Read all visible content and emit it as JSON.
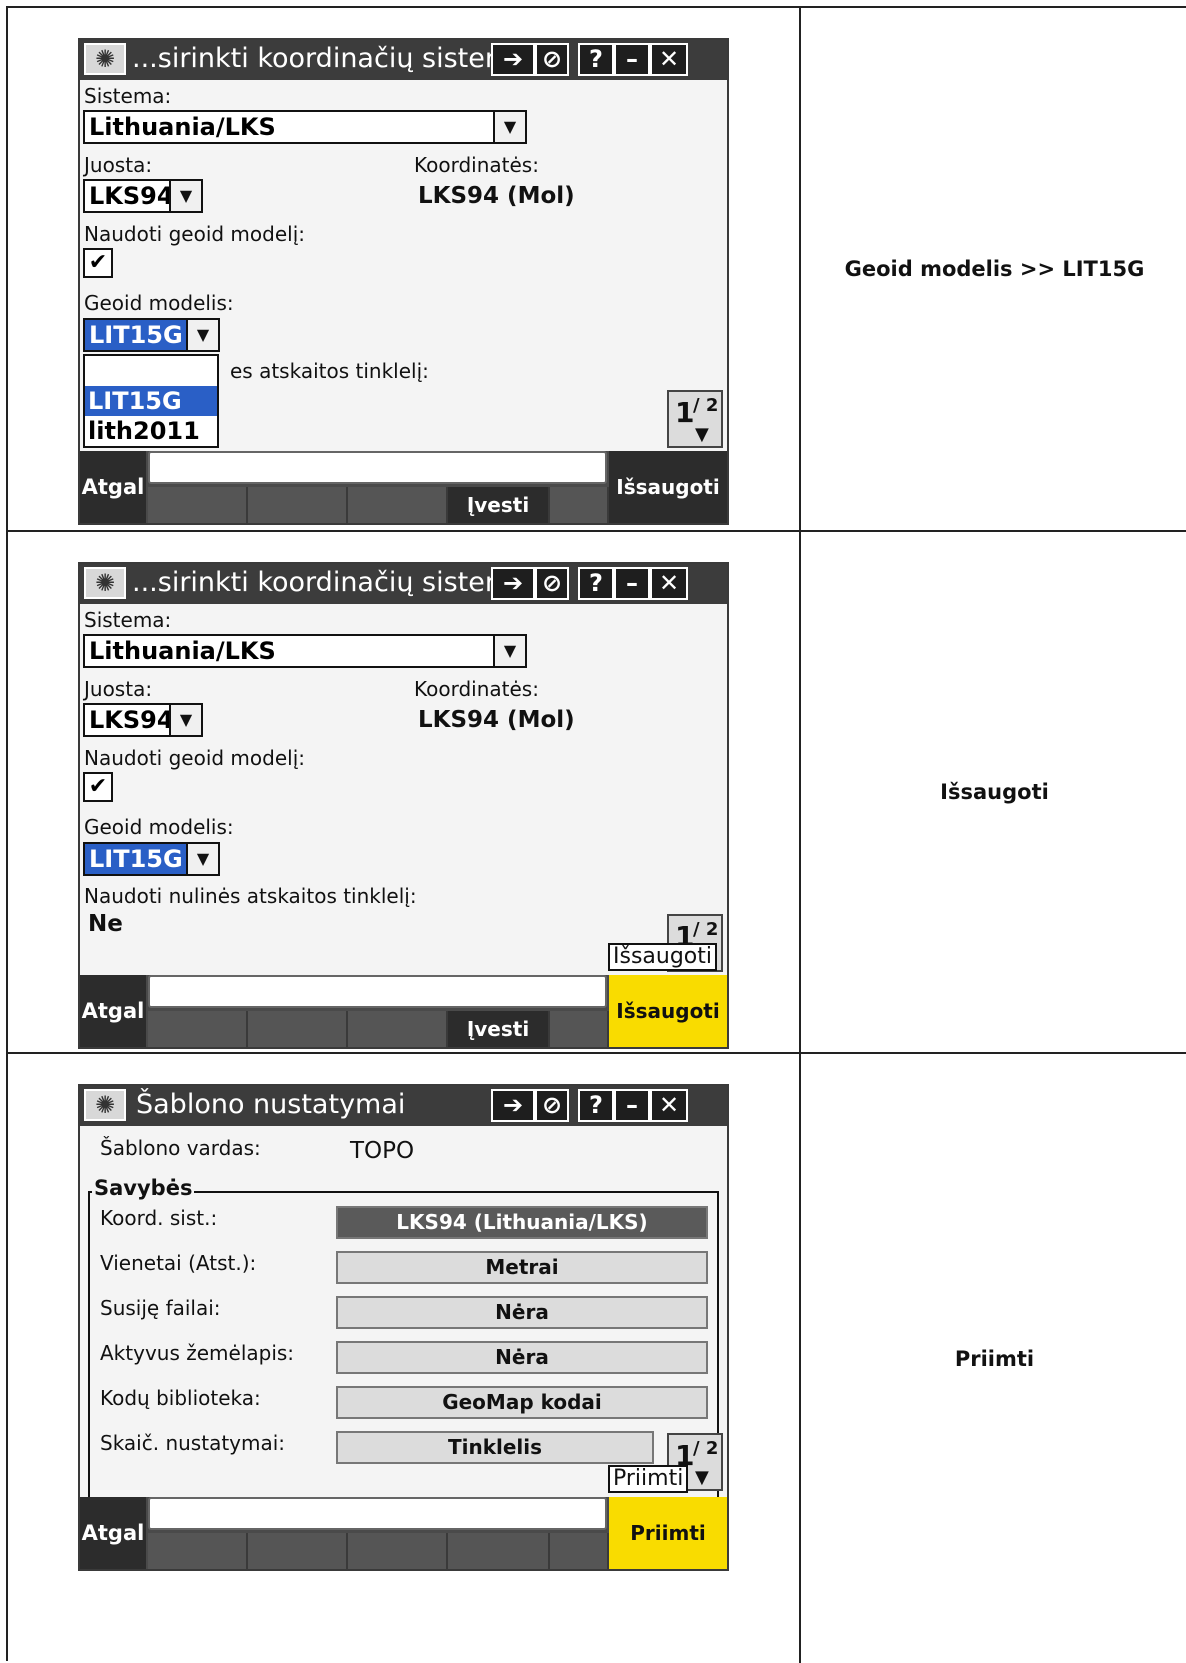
{
  "rows": [
    {
      "caption": "Geoid modelis >> LIT15G",
      "screen": {
        "title": "...sirinkti koordinačių sistemą",
        "sistema_label": "Sistema:",
        "sistema_value": "Lithuania/LKS",
        "juosta_label": "Juosta:",
        "juosta_value": "LKS94",
        "koordinates_label": "Koordinatės:",
        "koordinates_value": "LKS94 (Mol)",
        "geoid_use_label": "Naudoti geoid modelį:",
        "geoid_model_label": "Geoid modelis:",
        "geoid_model_value": "LIT15G",
        "partial_label": "es atskaitos tinklelį:",
        "dropdown_options": [
          "",
          "LIT15G",
          "lith2011"
        ],
        "page": "1",
        "page_total": "/ 2",
        "back": "Atgal",
        "enter": "Įvesti",
        "save": "Išsaugoti"
      }
    },
    {
      "caption": "Išsaugoti",
      "screen": {
        "title": "...sirinkti koordinačių sistemą",
        "sistema_label": "Sistema:",
        "sistema_value": "Lithuania/LKS",
        "juosta_label": "Juosta:",
        "juosta_value": "LKS94",
        "koordinates_label": "Koordinatės:",
        "koordinates_value": "LKS94 (Mol)",
        "geoid_use_label": "Naudoti geoid modelį:",
        "geoid_model_label": "Geoid modelis:",
        "geoid_model_value": "LIT15G",
        "grid_label": "Naudoti nulinės atskaitos tinklelį:",
        "grid_value": "Ne",
        "tooltip": "Išsaugoti",
        "page": "1",
        "page_total": "/ 2",
        "back": "Atgal",
        "enter": "Įvesti",
        "save": "Išsaugoti"
      }
    },
    {
      "caption": "Priimti",
      "screen": {
        "title": "Šablono nustatymai",
        "name_label": "Šablono vardas:",
        "name_value": "TOPO",
        "group_title": "Savybės",
        "properties": [
          {
            "label": "Koord. sist.:",
            "value": "LKS94 (Lithuania/LKS)"
          },
          {
            "label": "Vienetai (Atst.):",
            "value": "Metrai"
          },
          {
            "label": "Susiję failai:",
            "value": "Nėra"
          },
          {
            "label": "Aktyvus žemėlapis:",
            "value": "Nėra"
          },
          {
            "label": "Kodų biblioteka:",
            "value": "GeoMap kodai"
          },
          {
            "label": "Skaič. nustatymai:",
            "value": "Tinklelis"
          }
        ],
        "tooltip": "Priimti",
        "page": "1",
        "page_total": "/ 2",
        "back": "Atgal",
        "accept": "Priimti"
      }
    }
  ],
  "icons": {
    "logo": "trimble-globe-icon",
    "switch": "switch-app-icon",
    "stop": "stop-icon",
    "help": "help-icon",
    "minimize": "minimize-icon",
    "close": "close-icon"
  },
  "colors": {
    "highlight": "#2a5fc6",
    "accept_yellow": "#f9dc00",
    "titlebar": "#3c3c3c"
  }
}
